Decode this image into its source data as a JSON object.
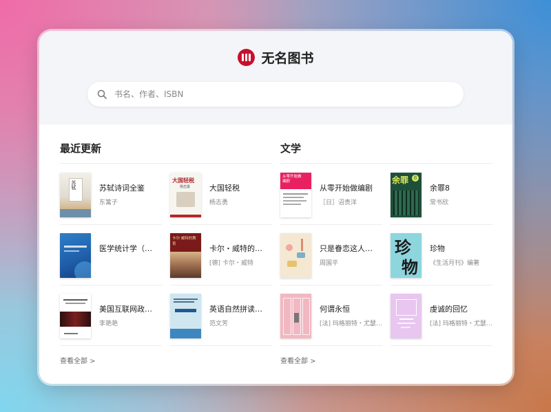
{
  "brand": {
    "name": "无名图书"
  },
  "search": {
    "placeholder": "书名、作者、ISBN"
  },
  "sections": [
    {
      "title": "最近更新",
      "more_label": "查看全部 >",
      "books": [
        {
          "title": "苏轼诗词全鉴",
          "author": "东篱子"
        },
        {
          "title": "大国轻税",
          "author": "杨志勇"
        },
        {
          "title": "医学统计学（…",
          "author": ""
        },
        {
          "title": "卡尔・威特的…",
          "author": "[德] 卡尔・威特"
        },
        {
          "title": "美国互联网政…",
          "author": "李艳艳"
        },
        {
          "title": "英语自然拼读…",
          "author": "范文芳"
        }
      ]
    },
    {
      "title": "文学",
      "more_label": "查看全部 >",
      "books": [
        {
          "title": "从零开始做编剧",
          "author": "［日］沼贵洋"
        },
        {
          "title": "余罪8",
          "author": "常书欣"
        },
        {
          "title": "只是眷恋这人…",
          "author": "周国平"
        },
        {
          "title": "珍物",
          "author": "《生活月刊》编著"
        },
        {
          "title": "何谓永恒",
          "author": "[法] 玛格丽特・尤瑟…"
        },
        {
          "title": "虔诚的回忆",
          "author": "[法] 玛格丽特・尤瑟…"
        }
      ]
    }
  ],
  "covers": {
    "dagu": "大国轻税",
    "dagu_sub": "杨志勇",
    "yuzui": "余罪",
    "yuzui_num": "8",
    "zhenwu_a": "珍",
    "zhenwu_b": "物",
    "kaer": "卡尔·威特的教育",
    "sushi": "苏轼",
    "bianju": "从零开始做编剧"
  },
  "colors": {
    "brand_red": "#c8102e"
  }
}
